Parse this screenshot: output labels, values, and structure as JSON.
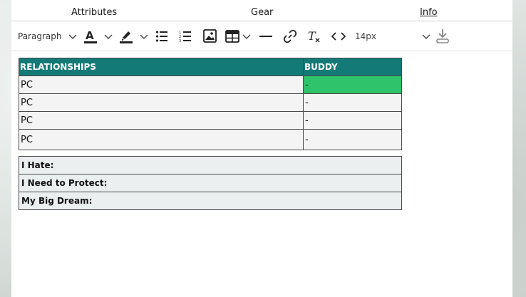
{
  "tabs": [
    {
      "label": "Attributes"
    },
    {
      "label": "Gear"
    },
    {
      "label": "Info"
    }
  ],
  "toolbar": {
    "paragraph_label": "Paragraph",
    "font_size_label": "14px",
    "icons": [
      "text-color-icon",
      "highlight-icon",
      "bullet-list-icon",
      "numbered-list-icon",
      "image-icon",
      "table-icon",
      "horizontal-rule-icon",
      "link-icon",
      "clear-format-icon",
      "code-icon",
      "download-icon"
    ]
  },
  "relationships_table": {
    "headers": [
      "RELATIONSHIPS",
      "BUDDY"
    ],
    "rows": [
      {
        "name": "PC",
        "buddy": "-"
      },
      {
        "name": "PC",
        "buddy": "-"
      },
      {
        "name": "PC",
        "buddy": "-"
      },
      {
        "name": "PC",
        "buddy": "-"
      }
    ],
    "highlight_color": "#2fc36b",
    "header_color": "#137a77"
  },
  "notes_table": {
    "rows": [
      "I Hate:",
      "I Need to Protect:",
      "My Big Dream:"
    ]
  }
}
